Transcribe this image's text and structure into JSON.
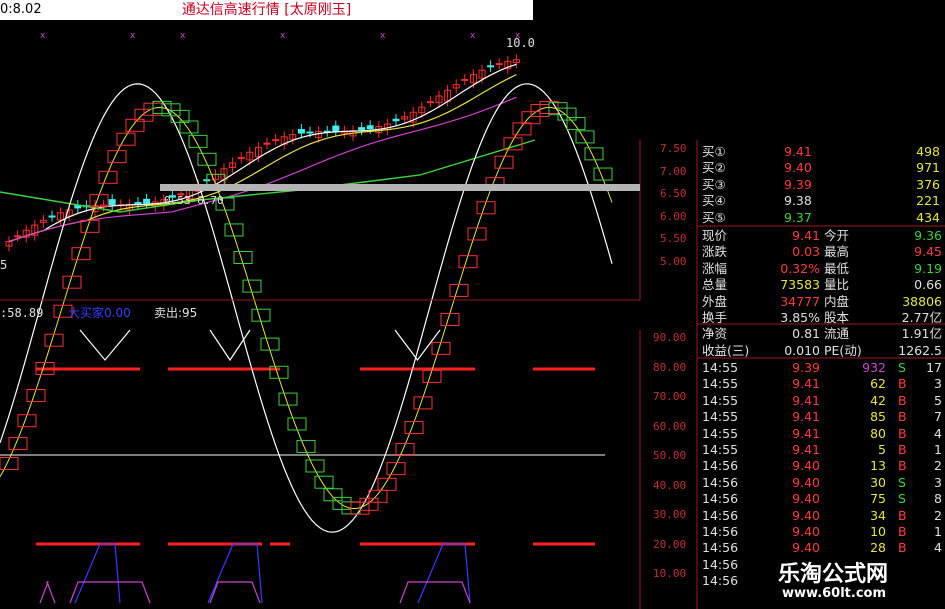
{
  "titlebar": {
    "price_label": "0:8.02",
    "title": "通达信高速行情 [太原刚玉]"
  },
  "kline": {
    "last_price_label": "10.0",
    "low_label": "5",
    "fib_label": "0.53-6.70",
    "y_ticks": [
      "7.50",
      "7.00",
      "6.50",
      "6.00",
      "5.50",
      "5.00"
    ],
    "colors": {
      "up": "#ff2a2a",
      "down": "#3cf0f0",
      "ma5": "#ffffff",
      "ma10": "#e6e63c",
      "ma20": "#d040d0",
      "ma60": "#3cd23c"
    }
  },
  "indicator": {
    "header_left": ":58.89",
    "header_mid": "大买家0.00",
    "header_right": "卖出:95",
    "y_ticks": [
      "90.00",
      "80.00",
      "70.00",
      "60.00",
      "50.00",
      "40.00",
      "30.00",
      "20.00",
      "10.00"
    ]
  },
  "quotes": {
    "bids": [
      {
        "label": "买①",
        "price": "9.41",
        "vol": "498"
      },
      {
        "label": "买②",
        "price": "9.40",
        "vol": "971"
      },
      {
        "label": "买③",
        "price": "9.39",
        "vol": "376"
      },
      {
        "label": "买④",
        "price": "9.38",
        "vol": "221"
      },
      {
        "label": "买⑤",
        "price": "9.37",
        "vol": "434"
      }
    ],
    "stats": [
      {
        "l1": "现价",
        "v1": "9.41",
        "l2": "今开",
        "v2": "9.36"
      },
      {
        "l1": "涨跌",
        "v1": "0.03",
        "l2": "最高",
        "v2": "9.45"
      },
      {
        "l1": "涨幅",
        "v1": "0.32%",
        "l2": "最低",
        "v2": "9.19"
      },
      {
        "l1": "总量",
        "v1": "73583",
        "l2": "量比",
        "v2": "0.66"
      },
      {
        "l1": "外盘",
        "v1": "34777",
        "l2": "内盘",
        "v2": "38806"
      },
      {
        "l1": "换手",
        "v1": "3.85%",
        "l2": "股本",
        "v2": "2.77亿"
      },
      {
        "l1": "净资",
        "v1": "0.81",
        "l2": "流通",
        "v2": "1.91亿"
      },
      {
        "l1": "收益(三)",
        "v1": "0.010",
        "l2": "PE(动)",
        "v2": "1262.5"
      }
    ],
    "ticks": [
      {
        "t": "14:55",
        "p": "9.39",
        "v": "932",
        "s": "S",
        "n": "17"
      },
      {
        "t": "14:55",
        "p": "9.41",
        "v": "62",
        "s": "B",
        "n": "3"
      },
      {
        "t": "14:55",
        "p": "9.41",
        "v": "42",
        "s": "B",
        "n": "5"
      },
      {
        "t": "14:55",
        "p": "9.41",
        "v": "85",
        "s": "B",
        "n": "7"
      },
      {
        "t": "14:55",
        "p": "9.41",
        "v": "80",
        "s": "B",
        "n": "4"
      },
      {
        "t": "14:55",
        "p": "9.41",
        "v": "5",
        "s": "B",
        "n": "1"
      },
      {
        "t": "14:56",
        "p": "9.40",
        "v": "13",
        "s": "B",
        "n": "2"
      },
      {
        "t": "14:56",
        "p": "9.40",
        "v": "30",
        "s": "S",
        "n": "3"
      },
      {
        "t": "14:56",
        "p": "9.40",
        "v": "75",
        "s": "S",
        "n": "8"
      },
      {
        "t": "14:56",
        "p": "9.40",
        "v": "34",
        "s": "B",
        "n": "2"
      },
      {
        "t": "14:56",
        "p": "9.40",
        "v": "10",
        "s": "B",
        "n": "1"
      },
      {
        "t": "14:56",
        "p": "9.40",
        "v": "28",
        "s": "B",
        "n": "4"
      },
      {
        "t": "14:56",
        "p": "",
        "v": "",
        "s": "",
        "n": ""
      },
      {
        "t": "14:56",
        "p": "",
        "v": "",
        "s": "",
        "n": ""
      }
    ]
  },
  "watermark": {
    "title": "乐淘公式网",
    "url": "www.60lt.com"
  }
}
